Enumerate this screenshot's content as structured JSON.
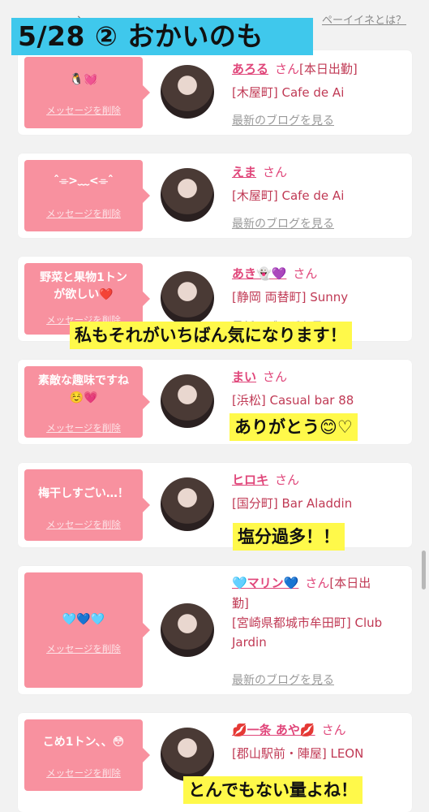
{
  "header": {
    "top_link": "ペーイイネとは？",
    "top_stub": "ヽ",
    "title": "5/28 ② おかいのも"
  },
  "delete_label": "メッセージを削除",
  "blog_label": "最新のブログを見る",
  "san_label": "さん",
  "cards": [
    {
      "message": "🐧💓",
      "name": "あろる",
      "status": "[本日出勤]",
      "shop": "[木屋町] Cafe de Ai"
    },
    {
      "message": "ˆ⌯>﹏<⌯ˆ",
      "name": "えま",
      "status": "",
      "shop": "[木屋町] Cafe de Ai"
    },
    {
      "message": "野菜と果物1トン\nが欲しい❤️",
      "name": "あき👻💜",
      "status": "",
      "shop": "[静岡 両替町] Sunny"
    },
    {
      "message": "素敵な趣味ですね\n☺️💗",
      "name": "まい",
      "status": "",
      "shop": "[浜松] Casual bar 88"
    },
    {
      "message": "梅干しすごい…！",
      "name": "ヒロキ",
      "status": "",
      "shop": "[国分町] Bar Aladdin"
    },
    {
      "message": "🩵💙🩵",
      "name": "🩵マリン💙",
      "status": "[本日出",
      "shop": "勤]\n[宮崎県都城市牟田町] Club\nJardin"
    },
    {
      "message": "こめ1トン、、😳",
      "name": "💋一条 あや💋",
      "status": "",
      "shop": "[郡山駅前・陣屋] LEON"
    }
  ],
  "captions": [
    "私もそれがいちばん気になります！",
    "ありがとう😊♡",
    "塩分過多！！",
    "とんでもない量よね！"
  ]
}
